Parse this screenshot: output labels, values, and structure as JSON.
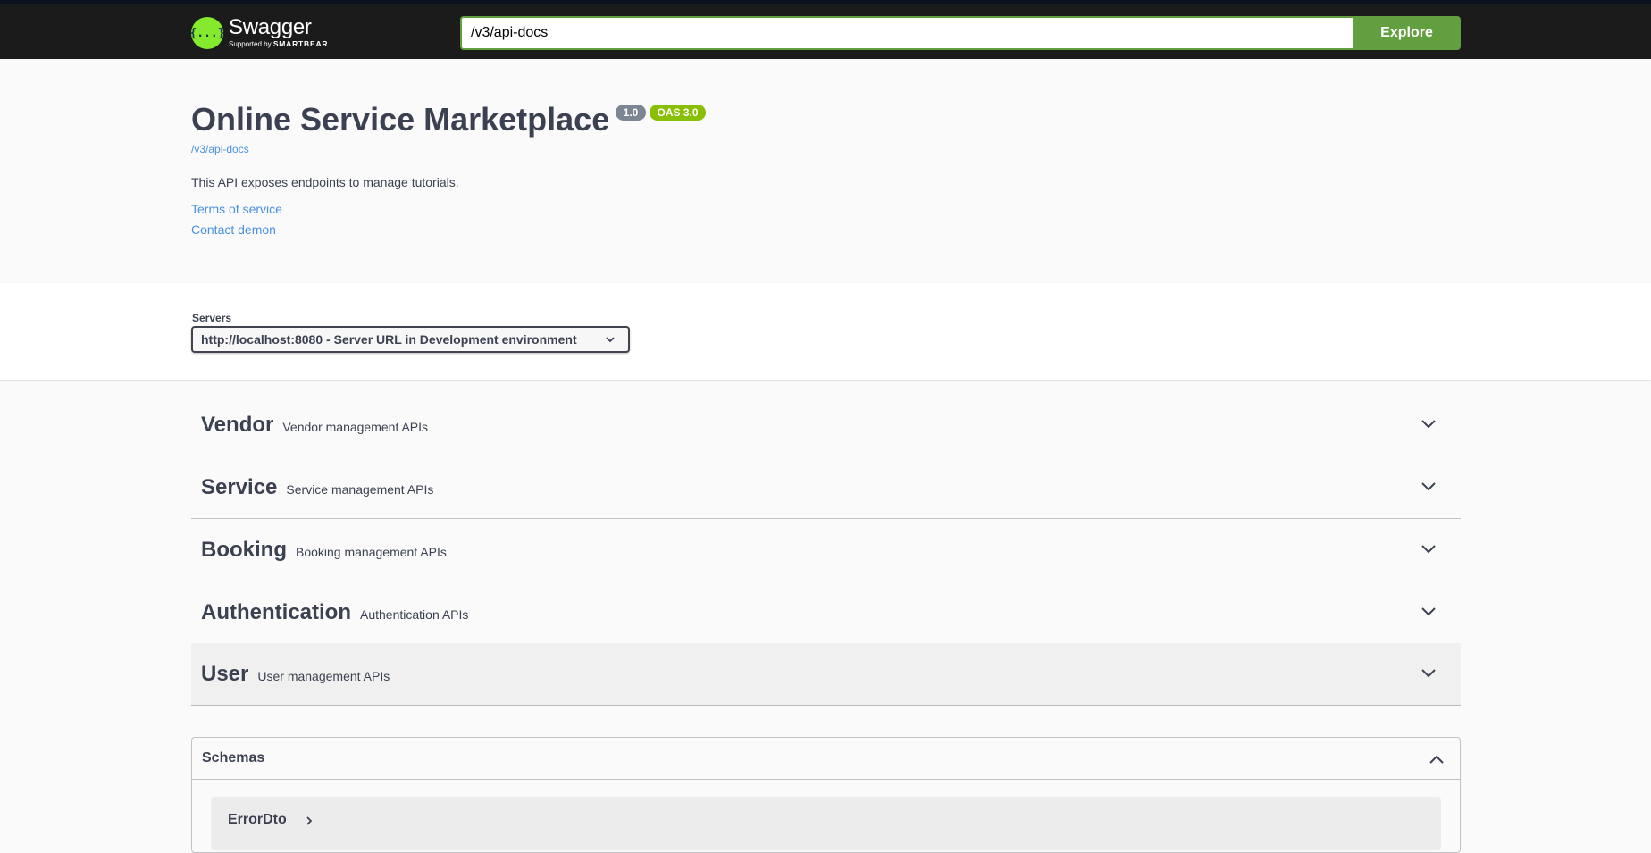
{
  "topbar": {
    "logo_mark": "{...}",
    "logo_name": "Swagger",
    "logo_supported": "Supported by",
    "logo_company": "SMARTBEAR",
    "url_value": "/v3/api-docs",
    "explore_label": "Explore"
  },
  "info": {
    "title": "Online Service Marketplace",
    "version": "1.0",
    "oas": "OAS 3.0",
    "spec_link": "/v3/api-docs",
    "description": "This API exposes endpoints to manage tutorials.",
    "terms": "Terms of service",
    "contact": "Contact demon"
  },
  "servers": {
    "label": "Servers",
    "selected": "http://localhost:8080 - Server URL in Development environment"
  },
  "tags": [
    {
      "name": "Vendor",
      "description": "Vendor management APIs"
    },
    {
      "name": "Service",
      "description": "Service management APIs"
    },
    {
      "name": "Booking",
      "description": "Booking management APIs"
    },
    {
      "name": "Authentication",
      "description": "Authentication APIs"
    },
    {
      "name": "User",
      "description": "User management APIs"
    }
  ],
  "schemas": {
    "title": "Schemas",
    "models": [
      {
        "name": "ErrorDto"
      }
    ]
  },
  "colors": {
    "topbar_bg": "#1b1b1b",
    "accent_green": "#62a03f",
    "logo_green": "#85ea2d",
    "oas_badge": "#89bf04",
    "version_badge": "#7d8492",
    "link_blue": "#4990e2",
    "text": "#3b4151"
  }
}
